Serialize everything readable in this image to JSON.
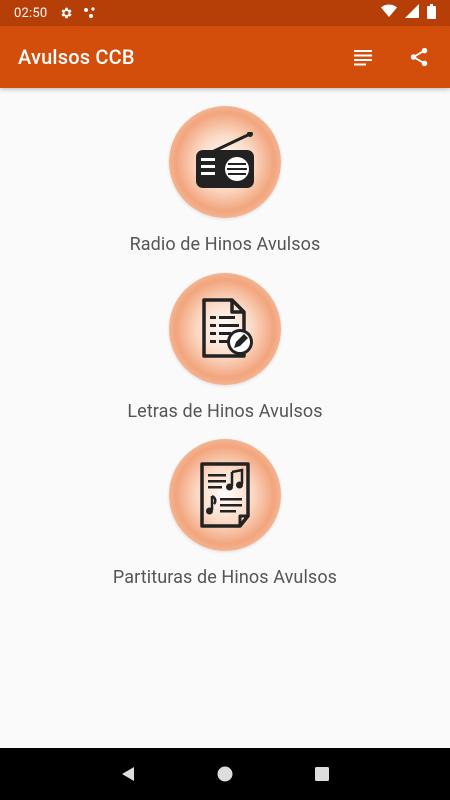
{
  "status_bar": {
    "time": "02:50",
    "icons": [
      "settings-icon",
      "notification-dots-icon",
      "wifi-icon",
      "signal-icon",
      "battery-icon"
    ]
  },
  "app_bar": {
    "title": "Avulsos CCB",
    "actions": [
      "list-icon",
      "share-icon"
    ]
  },
  "menu": [
    {
      "label": "Radio de Hinos Avulsos",
      "icon": "radio-icon"
    },
    {
      "label": "Letras de Hinos Avulsos",
      "icon": "document-edit-icon"
    },
    {
      "label": "Partituras de Hinos Avulsos",
      "icon": "sheet-music-icon"
    }
  ],
  "nav_bar": {
    "buttons": [
      "back-icon",
      "home-icon",
      "recents-icon"
    ]
  },
  "colors": {
    "status_bar": "#b63f08",
    "app_bar": "#d34e0b",
    "background": "#fafafa",
    "label_text": "#555555",
    "nav_bar": "#000000"
  }
}
